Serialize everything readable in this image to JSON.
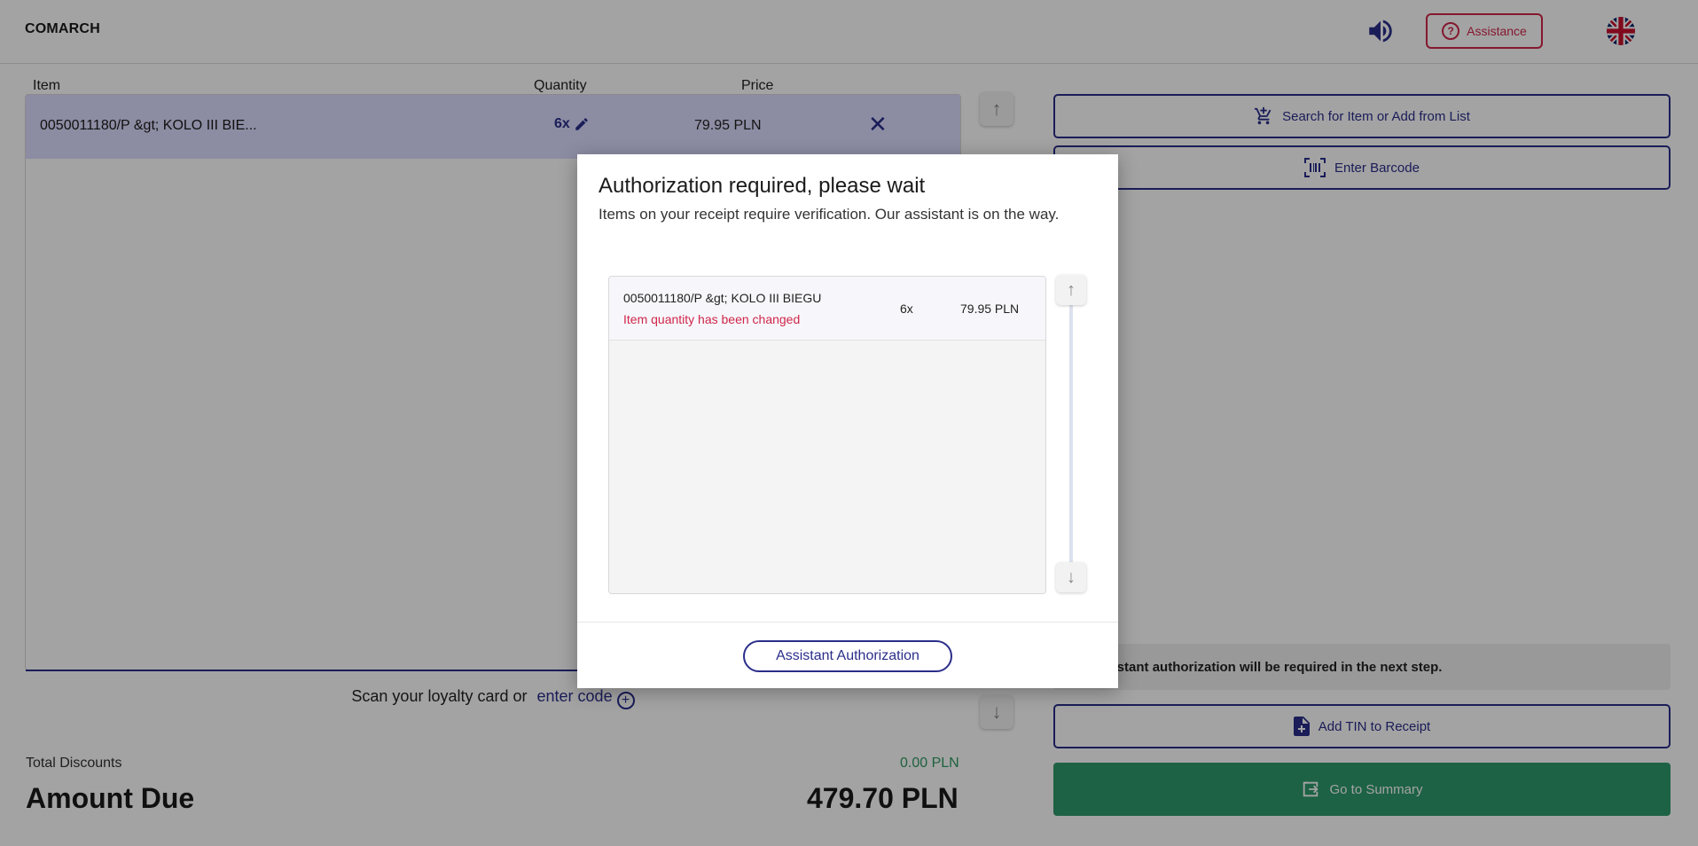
{
  "header": {
    "logo": "COMARCH",
    "assistance_label": "Assistance"
  },
  "columns": {
    "item": "Item",
    "quantity": "Quantity",
    "price": "Price"
  },
  "items": [
    {
      "name": "0050011180/P &gt; KOLO III BIE...",
      "qty": "6x",
      "price": "79.95 PLN"
    }
  ],
  "loyalty": {
    "text": "Scan your loyalty card or",
    "link": "enter code"
  },
  "totals": {
    "discounts_label": "Total Discounts",
    "discounts_value": "0.00 PLN",
    "due_label": "Amount Due",
    "due_value": "479.70 PLN"
  },
  "right": {
    "search_label": "Search for Item or Add from List",
    "barcode_label": "Enter Barcode",
    "notice": "Assistant authorization will be required in the next step.",
    "tin_label": "Add TIN to Receipt",
    "summary_label": "Go to Summary"
  },
  "modal": {
    "title": "Authorization required, please wait",
    "subtitle": "Items on your receipt require verification. Our assistant is on the way.",
    "items": [
      {
        "name": "0050011180/P &gt; KOLO III BIEGU",
        "warning": "Item quantity has been changed",
        "qty": "6x",
        "price": "79.95 PLN"
      }
    ],
    "auth_button": "Assistant Authorization"
  },
  "colors": {
    "accent": "#2a2e8a",
    "alert": "#d0264a",
    "success": "#2e9a6c"
  }
}
